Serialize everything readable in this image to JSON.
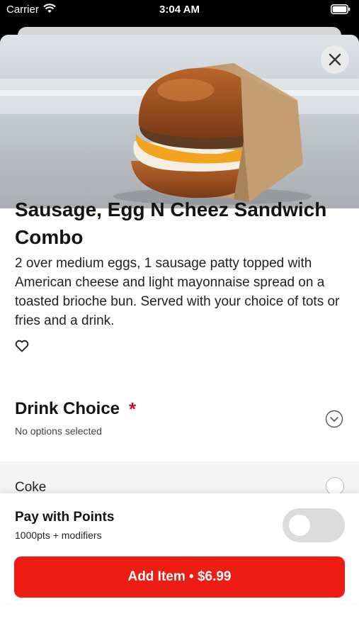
{
  "status_bar": {
    "carrier": "Carrier",
    "time": "3:04 AM"
  },
  "product": {
    "title": "Sausage, Egg N Cheez Sandwich Combo",
    "description": "2 over medium eggs, 1 sausage patty topped with American cheese and light mayonnaise spread on a toasted brioche bun. Served with your choice of tots or fries and a drink."
  },
  "modifier": {
    "title": "Drink Choice",
    "required_mark": "*",
    "status": "No options selected",
    "options": [
      {
        "label": "Coke",
        "selected": false
      }
    ]
  },
  "footer": {
    "points_title": "Pay with Points",
    "points_sub": "1000pts + modifiers",
    "points_enabled": false,
    "add_button": "Add Item • $6.99"
  },
  "colors": {
    "accent": "#ee1c12",
    "required": "#c8102e"
  },
  "icons": [
    "wifi-icon",
    "battery-icon",
    "close-icon",
    "heart-icon",
    "chevron-down-icon"
  ]
}
